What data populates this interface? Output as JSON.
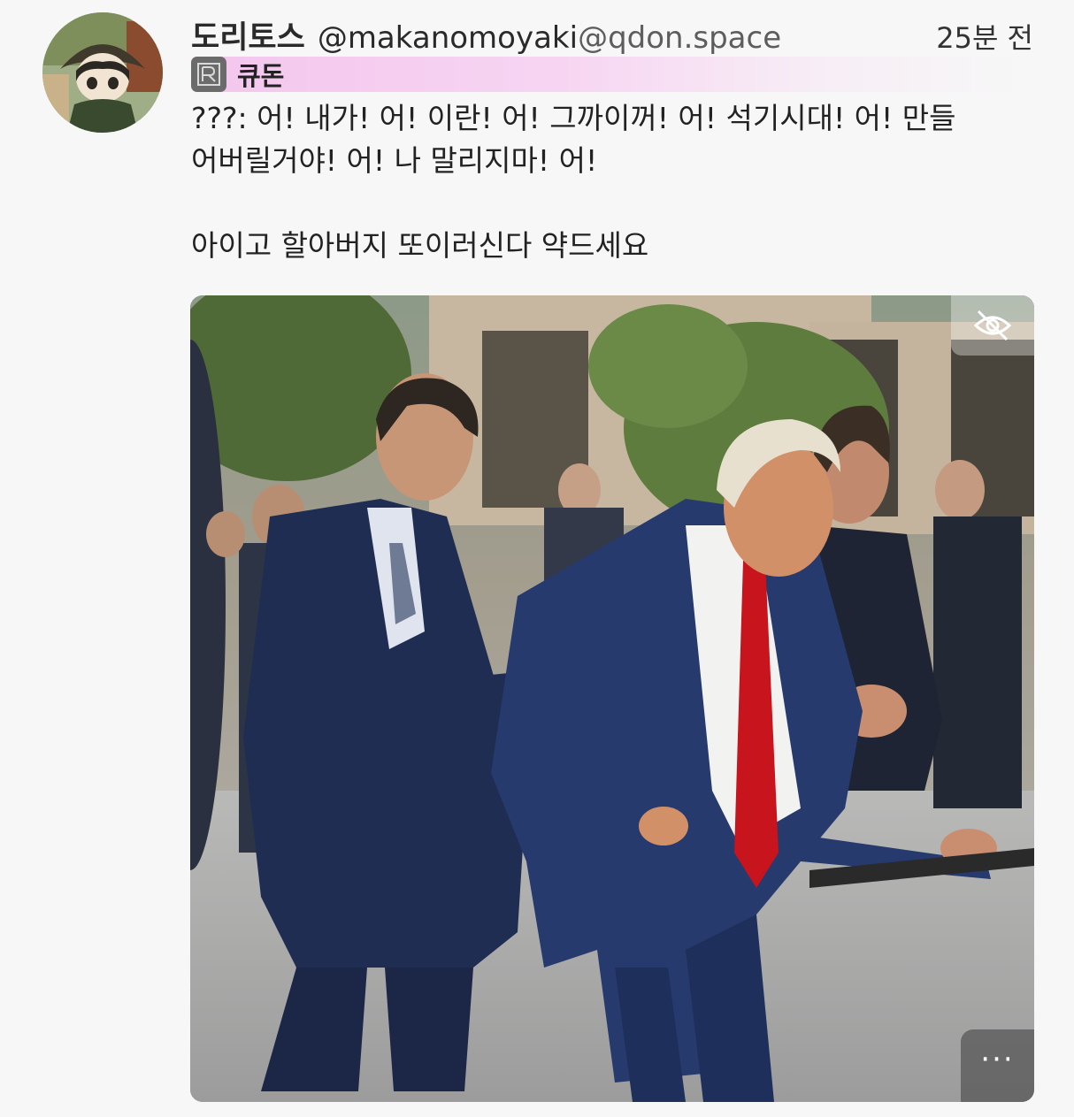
{
  "post": {
    "display_name": "도리토스",
    "handle_user": "@makanomoyaki",
    "handle_domain": "@qdon.space",
    "timestamp": "25분 전",
    "instance": {
      "name": "큐돈",
      "icon": "instance-logo-icon"
    },
    "content": {
      "line1": "???: 어! 내가! 어! 이란! 어! 그까이꺼! 어! 석기시대! 어! 만들",
      "line2": "어버릴거야! 어! 나 말리지마! 어!",
      "line3": "아이고 할아버지 또이러신다 약드세요"
    },
    "media": {
      "hide_icon": "eye-slash-icon",
      "more_label": "···"
    }
  },
  "colors": {
    "instance_bar": "#f4c6ee",
    "background": "#f7f7f7",
    "text": "#222222",
    "tie": "#c8141c",
    "suit": "#263a6e"
  }
}
